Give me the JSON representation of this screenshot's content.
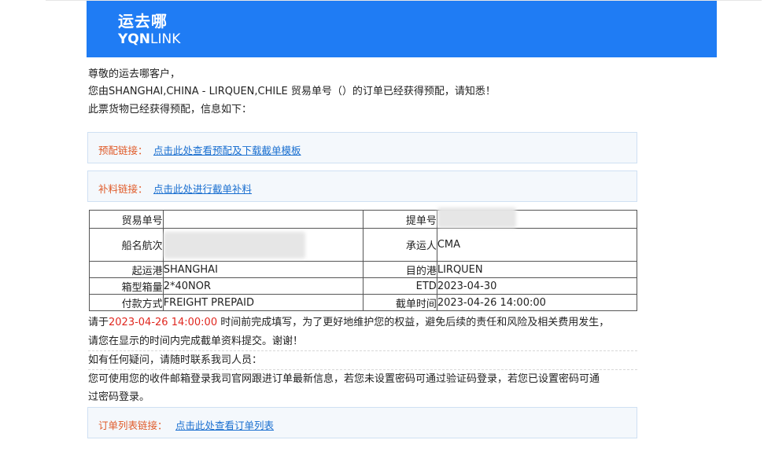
{
  "brand": {
    "name_cn": "运去哪",
    "name_en_bold": "YQN",
    "name_en_light": "LINK"
  },
  "greeting": "尊敬的运去哪客户，",
  "notice": "您由SHANGHAI,CHINA - LIRQUEN,CHILE 贸易单号（）的订单已经获得预配，请知悉！",
  "info_intro": "此票货物已经获得预配，信息如下：",
  "links": {
    "preconfig": {
      "label": "预配链接：",
      "text": "点击此处查看预配及下载截单模板"
    },
    "supplement": {
      "label": "补料链接：",
      "text": "点击此处进行截单补料"
    },
    "order_list": {
      "label": "订单列表链接：",
      "text": "点击此处查看订单列表"
    }
  },
  "table": {
    "trade_no_label": "贸易单号",
    "trade_no_value": "",
    "bl_no_label": "提单号",
    "vessel_label": "船名航次",
    "carrier_label": "承运人",
    "carrier_value": "CMA",
    "pol_label": "起运港",
    "pol_value": "SHANGHAI",
    "pod_label": "目的港",
    "pod_value": "LIRQUEN",
    "container_label": "箱型箱量",
    "container_value": "2*40NOR",
    "etd_label": "ETD",
    "etd_value": "2023-04-30",
    "payment_label": "付款方式",
    "payment_value": "FREIGHT PREPAID",
    "cutoff_label": "截单时间",
    "cutoff_value": "2023-04-26 14:00:00"
  },
  "deadline": {
    "prefix": "请于",
    "time": "2023-04-26 14:00:00",
    "suffix": " 时间前完成填写，为了更好地维护您的权益，避免后续的责任和风险及相关费用发生，",
    "line2": "请您在显示的时间内完成截单资料提交。谢谢！"
  },
  "contact": "如有任何疑问，请随时联系我司人员：",
  "login_line1": "您可使用您的收件邮箱登录我司官网跟进订单最新信息，若您未设置密码可通过验证码登录，若您已设置密码可通",
  "login_line2": "过密码登录。",
  "colors": {
    "brand_blue": "#1f7cf4",
    "link_label_orange": "#e05b2a",
    "link_blue": "#1a6fd0",
    "deadline_red": "#e0271f"
  }
}
